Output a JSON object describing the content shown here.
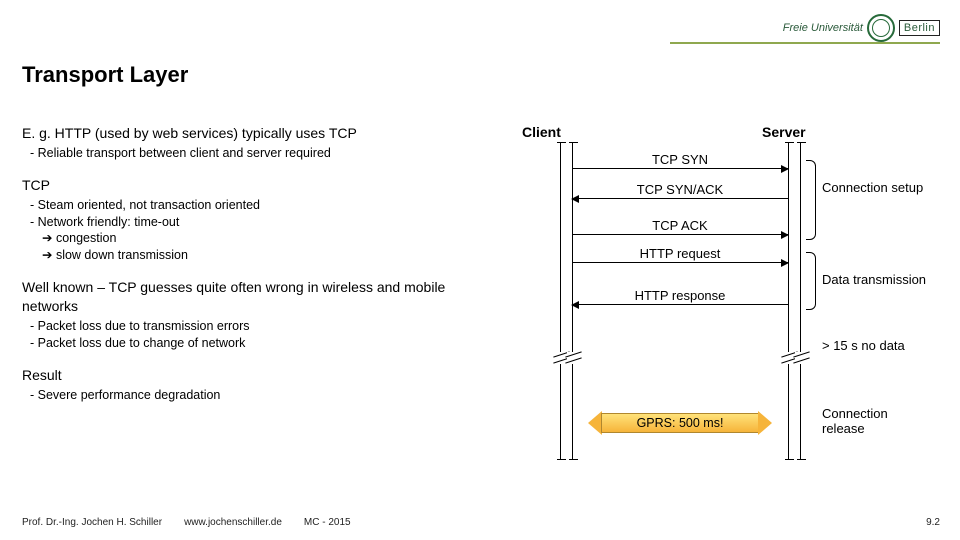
{
  "header": {
    "university_name": "Freie Universität",
    "city": "Berlin"
  },
  "title": "Transport Layer",
  "sections": [
    {
      "head": "E. g. HTTP (used by web services) typically uses TCP",
      "subs": [
        {
          "text": "- Reliable transport between client and server required"
        }
      ]
    },
    {
      "head": "TCP",
      "subs": [
        {
          "text": "- Steam oriented, not transaction oriented"
        },
        {
          "text": "- Network friendly: time-out"
        },
        {
          "text": "congestion",
          "indent": true,
          "arrow": true
        },
        {
          "text": "slow down transmission",
          "indent": true,
          "arrow": true
        }
      ]
    },
    {
      "head": "Well known – TCP guesses quite often wrong in wireless and mobile networks",
      "subs": [
        {
          "text": "- Packet loss due to transmission errors"
        },
        {
          "text": "- Packet loss due to change of network"
        }
      ]
    },
    {
      "head": "Result",
      "subs": [
        {
          "text": "- Severe performance degradation"
        }
      ]
    }
  ],
  "diagram": {
    "client_label": "Client",
    "server_label": "Server",
    "messages": {
      "syn": "TCP SYN",
      "synack": "TCP SYN/ACK",
      "ack": "TCP ACK",
      "req": "HTTP request",
      "resp": "HTTP response"
    },
    "annotations": {
      "conn_setup": "Connection setup",
      "data_tx": "Data transmission",
      "timeout": "> 15 s no data",
      "conn_release": "Connection release",
      "gprs": "GPRS: 500 ms!"
    }
  },
  "footer": {
    "author": "Prof. Dr.-Ing. Jochen H. Schiller",
    "url": "www.jochenschiller.de",
    "course": "MC - 2015",
    "page": "9.2"
  }
}
